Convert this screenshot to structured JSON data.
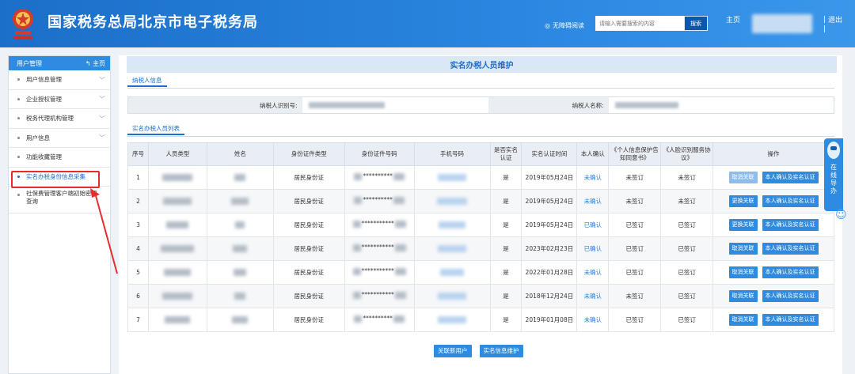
{
  "header": {
    "site_title": "国家税务总局北京市电子税务局",
    "accessibility": "无障碍阅读",
    "search_placeholder": "请输入需要搜索的内容",
    "search_button": "搜索",
    "home": "主页",
    "sep": "|",
    "logout": "退出"
  },
  "sidebar": {
    "title": "用户管理",
    "home_link": "主页",
    "items": [
      {
        "label": "用户信息管理",
        "expandable": true
      },
      {
        "label": "企业授权管理",
        "expandable": true
      },
      {
        "label": "税务代理机构管理",
        "expandable": true
      },
      {
        "label": "用户信息",
        "expandable": true
      },
      {
        "label": "功能收藏管理",
        "expandable": false
      },
      {
        "label": "实名办税身份信息采集",
        "expandable": false,
        "active": true
      },
      {
        "label": "社保费管理客户端初始密码查询",
        "expandable": false
      }
    ]
  },
  "main": {
    "page_title": "实名办税人员维护",
    "tab_taxpayer": "纳税人信息",
    "taxpayer_id_label": "纳税人识别号:",
    "taxpayer_name_label": "纳税人名称:",
    "tab_list": "实名办税人员列表",
    "columns": [
      "序号",
      "人员类型",
      "姓名",
      "身份证件类型",
      "身份证件号码",
      "手机号码",
      "是否实名认证",
      "实名认证时间",
      "本人确认",
      "《个人信息保护告知同意书》",
      "《人脸识别服务协议》",
      "操作"
    ],
    "rows": [
      {
        "no": "1",
        "id_type": "居民身份证",
        "id_number": "**********",
        "verified": "是",
        "date": "2019年05月24日",
        "confirm": "未确认",
        "privacy": "未签订",
        "face": "未签订",
        "btn1": "取消关联",
        "btn1_disabled": true,
        "btn2": "本人确认及实名认证"
      },
      {
        "no": "2",
        "id_type": "居民身份证",
        "id_number": "**********",
        "verified": "是",
        "date": "2019年05月24日",
        "confirm": "未确认",
        "privacy": "未签订",
        "face": "未签订",
        "btn1": "更换关联",
        "btn1_disabled": false,
        "btn2": "本人确认及实名认证"
      },
      {
        "no": "3",
        "id_type": "居民身份证",
        "id_number": "***********",
        "verified": "是",
        "date": "2019年05月24日",
        "confirm": "已确认",
        "privacy": "已签订",
        "face": "已签订",
        "btn1": "更换关联",
        "btn1_disabled": false,
        "btn2": "本人确认及实名认证"
      },
      {
        "no": "4",
        "id_type": "居民身份证",
        "id_number": "***********",
        "verified": "是",
        "date": "2023年02月23日",
        "confirm": "已确认",
        "privacy": "已签订",
        "face": "已签订",
        "btn1": "取消关联",
        "btn1_disabled": false,
        "btn2": "本人确认及实名认证"
      },
      {
        "no": "5",
        "id_type": "居民身份证",
        "id_number": "***********",
        "verified": "是",
        "date": "2022年01月28日",
        "confirm": "未确认",
        "privacy": "已签订",
        "face": "已签订",
        "btn1": "取消关联",
        "btn1_disabled": false,
        "btn2": "本人确认及实名认证"
      },
      {
        "no": "6",
        "id_type": "居民身份证",
        "id_number": "***********",
        "verified": "是",
        "date": "2018年12月24日",
        "confirm": "未确认",
        "privacy": "未签订",
        "face": "已签订",
        "btn1": "取消关联",
        "btn1_disabled": false,
        "btn2": "本人确认及实名认证"
      },
      {
        "no": "7",
        "id_type": "居民身份证",
        "id_number": "**********",
        "verified": "是",
        "date": "2019年01月08日",
        "confirm": "未确认",
        "privacy": "已签订",
        "face": "已签订",
        "btn1": "取消关联",
        "btn1_disabled": false,
        "btn2": "本人确认及实名认证"
      }
    ],
    "btn_link_user": "关联新用户",
    "btn_maintain": "实名信息维护"
  },
  "float_nav": {
    "label": "在线导办"
  },
  "colors": {
    "primary": "#2e8be0",
    "header": "#1b6fc8",
    "highlight": "#e52d2d"
  }
}
